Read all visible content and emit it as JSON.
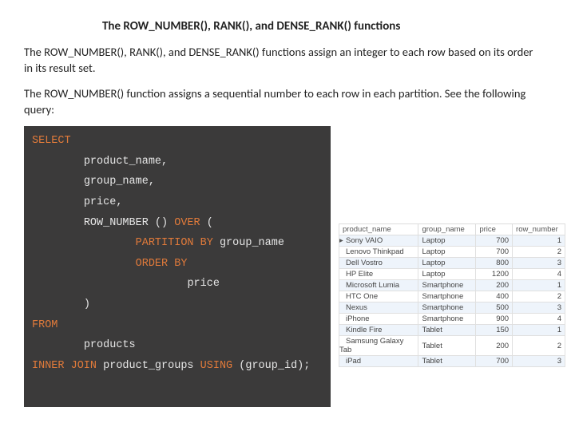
{
  "title": "The ROW_NUMBER(), RANK(), and DENSE_RANK() functions",
  "paragraphs": {
    "p1": "The ROW_NUMBER(), RANK(), and DENSE_RANK() functions assign an integer to each row based on its order in its result set.",
    "p2": "The ROW_NUMBER() function assigns a sequential number to each row in each partition. See the following query:"
  },
  "code": {
    "select": "SELECT",
    "col1": "product_name,",
    "col2": "group_name,",
    "col3": "price,",
    "rn": "ROW_NUMBER",
    "over_open": " () ",
    "over_kw": "OVER",
    "paren_open": " (",
    "partition": "PARTITION BY",
    "partition_arg": " group_name",
    "order": "ORDER BY",
    "order_arg": "price",
    "paren_close": ")",
    "from": "FROM",
    "table": "products",
    "join": "INNER JOIN",
    "join_args": " product_groups ",
    "using": "USING",
    "using_args": " (group_id);"
  },
  "result": {
    "headers": [
      "product_name",
      "group_name",
      "price",
      "row_number"
    ],
    "cursor_glyph": "▸",
    "rows": [
      {
        "cursor": true,
        "cells": [
          "Sony VAIO",
          "Laptop",
          "700",
          "1"
        ]
      },
      {
        "cursor": false,
        "cells": [
          "Lenovo Thinkpad",
          "Laptop",
          "700",
          "2"
        ]
      },
      {
        "cursor": false,
        "cells": [
          "Dell Vostro",
          "Laptop",
          "800",
          "3"
        ]
      },
      {
        "cursor": false,
        "cells": [
          "HP Elite",
          "Laptop",
          "1200",
          "4"
        ]
      },
      {
        "cursor": false,
        "cells": [
          "Microsoft Lumia",
          "Smartphone",
          "200",
          "1"
        ]
      },
      {
        "cursor": false,
        "cells": [
          "HTC One",
          "Smartphone",
          "400",
          "2"
        ]
      },
      {
        "cursor": false,
        "cells": [
          "Nexus",
          "Smartphone",
          "500",
          "3"
        ]
      },
      {
        "cursor": false,
        "cells": [
          "iPhone",
          "Smartphone",
          "900",
          "4"
        ]
      },
      {
        "cursor": false,
        "cells": [
          "Kindle Fire",
          "Tablet",
          "150",
          "1"
        ]
      },
      {
        "cursor": false,
        "cells": [
          "Samsung Galaxy Tab",
          "Tablet",
          "200",
          "2"
        ]
      },
      {
        "cursor": false,
        "cells": [
          "iPad",
          "Tablet",
          "700",
          "3"
        ]
      }
    ]
  },
  "chart_data": {
    "type": "table",
    "title": "ROW_NUMBER() result set",
    "columns": [
      "product_name",
      "group_name",
      "price",
      "row_number"
    ],
    "rows": [
      [
        "Sony VAIO",
        "Laptop",
        700,
        1
      ],
      [
        "Lenovo Thinkpad",
        "Laptop",
        700,
        2
      ],
      [
        "Dell Vostro",
        "Laptop",
        800,
        3
      ],
      [
        "HP Elite",
        "Laptop",
        1200,
        4
      ],
      [
        "Microsoft Lumia",
        "Smartphone",
        200,
        1
      ],
      [
        "HTC One",
        "Smartphone",
        400,
        2
      ],
      [
        "Nexus",
        "Smartphone",
        500,
        3
      ],
      [
        "iPhone",
        "Smartphone",
        900,
        4
      ],
      [
        "Kindle Fire",
        "Tablet",
        150,
        1
      ],
      [
        "Samsung Galaxy Tab",
        "Tablet",
        200,
        2
      ],
      [
        "iPad",
        "Tablet",
        700,
        3
      ]
    ]
  }
}
